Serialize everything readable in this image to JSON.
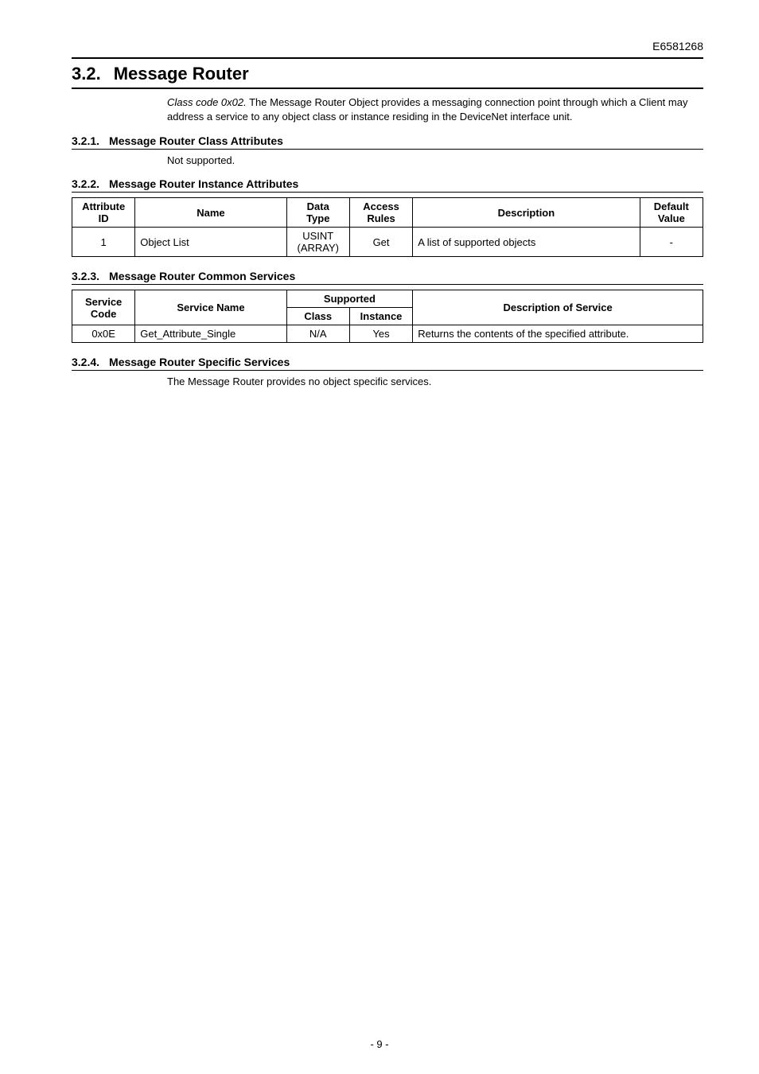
{
  "doc_id": "E6581268",
  "section": {
    "number": "3.2.",
    "title": "Message Router",
    "intro_italic": "Class code 0x02.",
    "intro_rest": " The Message Router Object provides a messaging connection point through which a Client may address a service to any object class or instance residing in the DeviceNet interface unit."
  },
  "sub": [
    {
      "number": "3.2.1.",
      "title": "Message Router Class Attributes",
      "body": "Not supported."
    },
    {
      "number": "3.2.2.",
      "title": "Message Router Instance Attributes"
    },
    {
      "number": "3.2.3.",
      "title": "Message Router Common Services"
    },
    {
      "number": "3.2.4.",
      "title": "Message Router Specific Services",
      "body": "The Message Router provides no object specific services."
    }
  ],
  "table_attr": {
    "headers": {
      "attr_id_l1": "Attribute",
      "attr_id_l2": "ID",
      "name": "Name",
      "dt_l1": "Data",
      "dt_l2": "Type",
      "ar_l1": "Access",
      "ar_l2": "Rules",
      "desc": "Description",
      "dv_l1": "Default",
      "dv_l2": "Value"
    },
    "row": {
      "id": "1",
      "name": "Object List",
      "dt_l1": "USINT",
      "dt_l2": "(ARRAY)",
      "access": "Get",
      "desc": "A list of supported objects",
      "default": "-"
    }
  },
  "table_svc": {
    "headers": {
      "sc_l1": "Service",
      "sc_l2": "Code",
      "name": "Service Name",
      "supported": "Supported",
      "class": "Class",
      "instance": "Instance",
      "desc": "Description of Service"
    },
    "row": {
      "code": "0x0E",
      "name": "Get_Attribute_Single",
      "class": "N/A",
      "instance": "Yes",
      "desc": "Returns the contents of the specified attribute."
    }
  },
  "footer": "- 9 -"
}
